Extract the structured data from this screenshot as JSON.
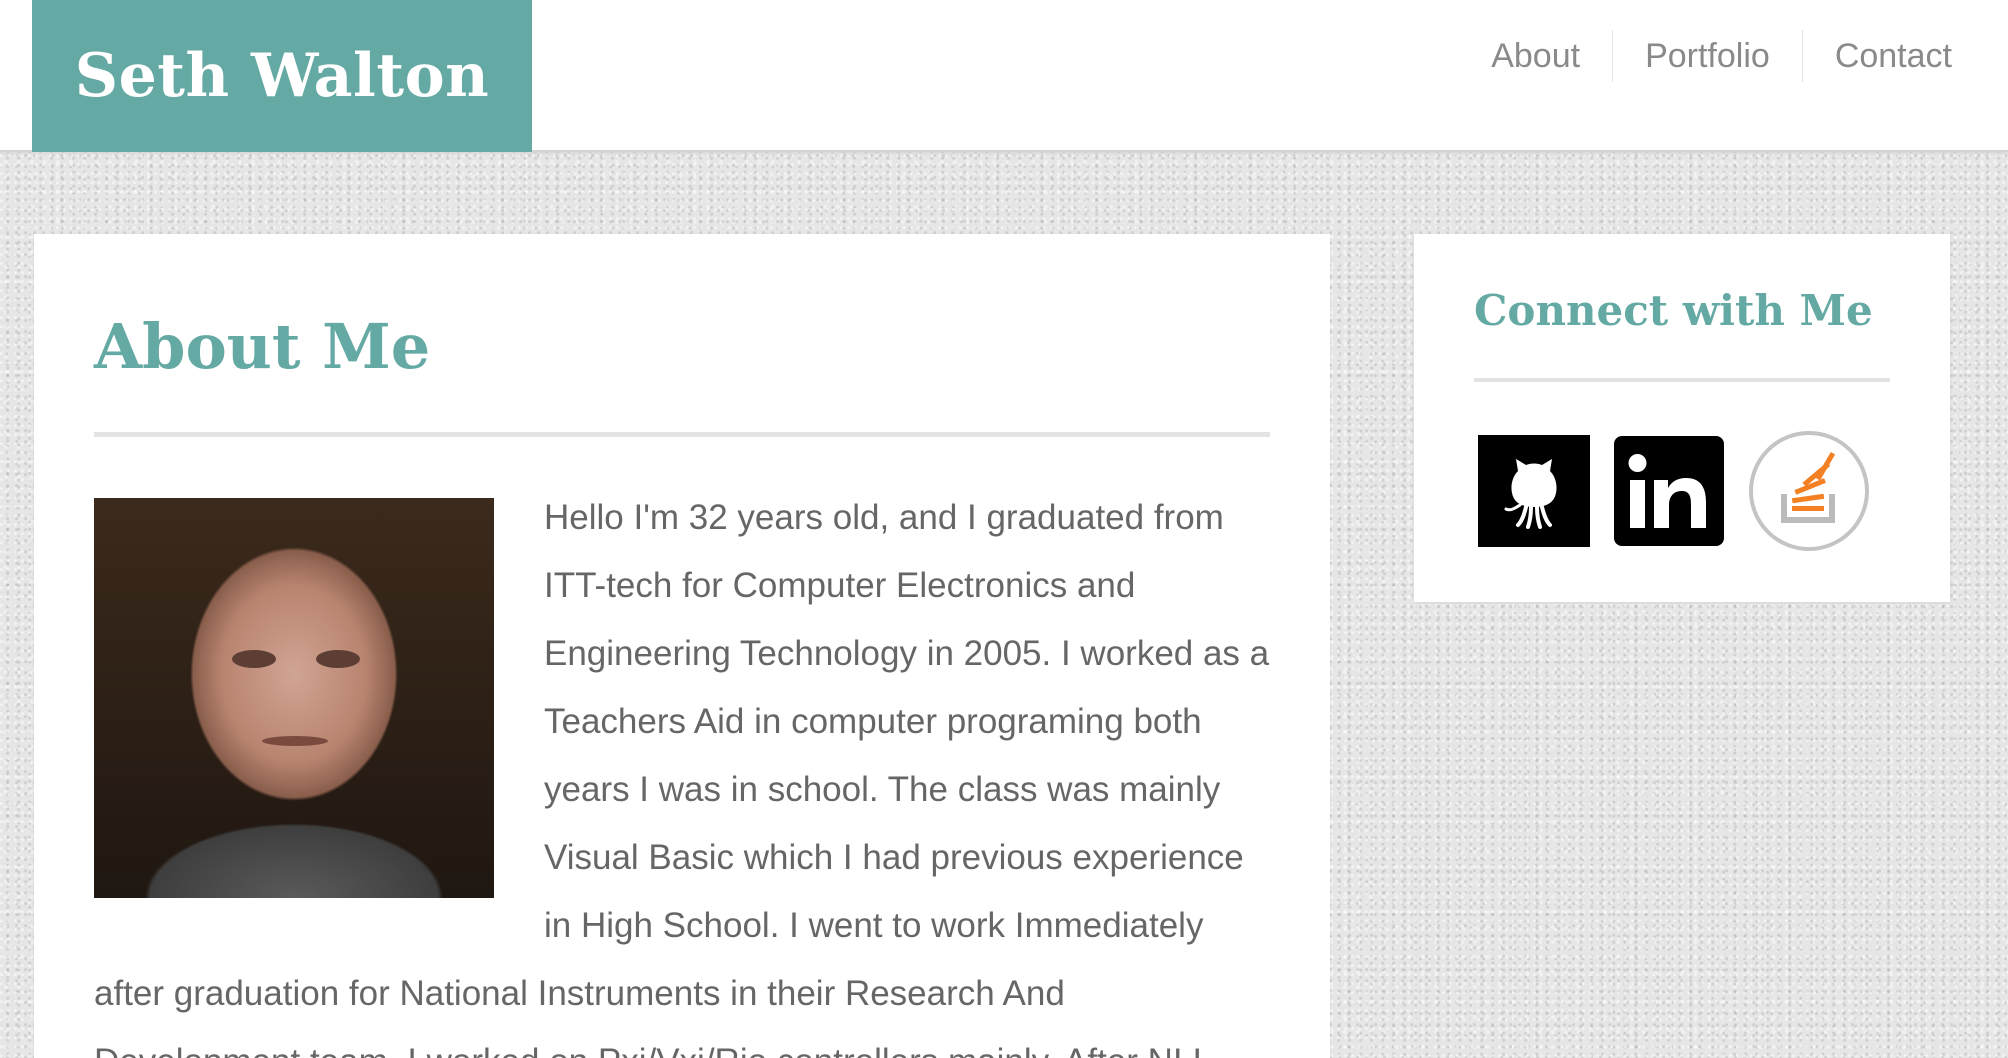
{
  "header": {
    "brand": "Seth Walton",
    "brand_color": "#64a9a3",
    "nav": [
      {
        "label": "About"
      },
      {
        "label": "Portfolio"
      },
      {
        "label": "Contact"
      }
    ]
  },
  "main": {
    "title": "About Me",
    "paragraph": "Hello I'm 32 years old, and I graduated from ITT-tech for Computer Electronics and Engineering Technology in 2005. I worked as a Teachers Aid in computer programing both years I was in school. The class was mainly Visual Basic which I had previous experience in High School. I went to work Immediately after graduation for National Instruments in their Research And Development team. I worked on Pxi/Vxi/Rio controllers mainly. After NI I"
  },
  "sidebar": {
    "title": "Connect with Me",
    "social": [
      {
        "icon": "github-icon"
      },
      {
        "icon": "linkedin-icon"
      },
      {
        "icon": "stackoverflow-icon"
      }
    ]
  },
  "colors": {
    "accent": "#64a9a3",
    "text": "#666666",
    "nav_text": "#8a8a8a",
    "stackoverflow_orange": "#f48024"
  }
}
